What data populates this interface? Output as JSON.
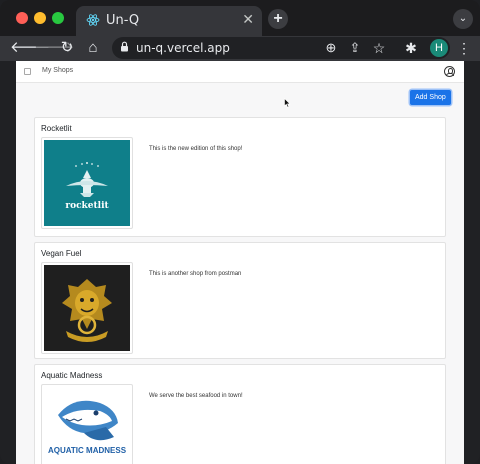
{
  "browser": {
    "tab_title": "Un-Q",
    "tab_close": "✕",
    "new_tab": "+",
    "tab_menu": "⌄",
    "url": "un-q.vercel.app",
    "profile_initial": "H",
    "icons": {
      "back": "🡐",
      "forward": "🡒",
      "reload": "↻",
      "home": "⌂",
      "zoom": "⊕",
      "share": "⇪",
      "bookmark": "☆",
      "extensions": "✱",
      "menu": "⋮",
      "lock": "🔒"
    }
  },
  "navbar": {
    "link": "My Shops"
  },
  "actions": {
    "add_shop": "Add Shop"
  },
  "shops": [
    {
      "name": "Rocketlit",
      "description": "This is the new edition of this shop!",
      "logo_text": "rocketlit"
    },
    {
      "name": "Vegan Fuel",
      "description": "This is another shop from postman"
    },
    {
      "name": "Aquatic Madness",
      "description": "We serve the best seafood in town!",
      "logo_text": "AQUATIC MADNESS"
    }
  ],
  "colors": {
    "accent": "#1a73e8",
    "rocketlit_bg": "#0f7f8a",
    "vegan_bg": "#1f1f1f"
  }
}
